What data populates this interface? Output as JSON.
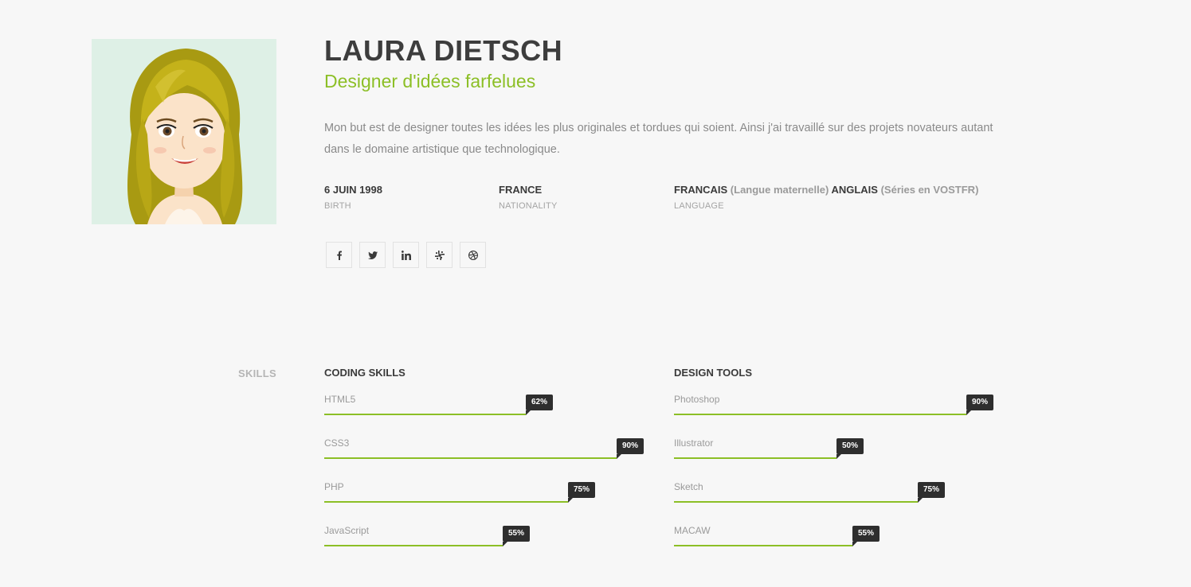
{
  "profile": {
    "name": "LAURA DIETSCH",
    "role": "Designer d'idées farfelues",
    "bio": "Mon but est de designer toutes les idées les plus originales et tordues qui soient. Ainsi j'ai travaillé sur des projets novateurs autant dans le domaine artistique que technologique."
  },
  "info": {
    "birth": {
      "value": "6 JUIN 1998",
      "label": "BIRTH"
    },
    "nationality": {
      "value": "FRANCE",
      "label": "NATIONALITY"
    },
    "language": {
      "lang1": "FRANCAIS",
      "lang1_note": "(Langue maternelle)",
      "lang2": "ANGLAIS",
      "lang2_note": "(Séries en VOSTFR)",
      "label": "LANGUAGE"
    }
  },
  "social": [
    {
      "icon": "facebook-icon"
    },
    {
      "icon": "twitter-icon"
    },
    {
      "icon": "linkedin-icon"
    },
    {
      "icon": "slack-icon"
    },
    {
      "icon": "dribbble-icon"
    }
  ],
  "skills": {
    "section_label": "SKILLS",
    "coding": {
      "title": "CODING SKILLS",
      "items": [
        {
          "name": "HTML5",
          "percent": 62,
          "label": "62%"
        },
        {
          "name": "CSS3",
          "percent": 90,
          "label": "90%"
        },
        {
          "name": "PHP",
          "percent": 75,
          "label": "75%"
        },
        {
          "name": "JavaScript",
          "percent": 55,
          "label": "55%"
        }
      ]
    },
    "design": {
      "title": "DESIGN TOOLS",
      "items": [
        {
          "name": "Photoshop",
          "percent": 90,
          "label": "90%"
        },
        {
          "name": "Illustrator",
          "percent": 50,
          "label": "50%"
        },
        {
          "name": "Sketch",
          "percent": 75,
          "label": "75%"
        },
        {
          "name": "MACAW",
          "percent": 55,
          "label": "55%"
        }
      ]
    }
  },
  "colors": {
    "accent": "#8cbf26",
    "heading": "#3d3d3d",
    "muted": "#9a9a9a",
    "tooltip": "#2e2e2e"
  }
}
